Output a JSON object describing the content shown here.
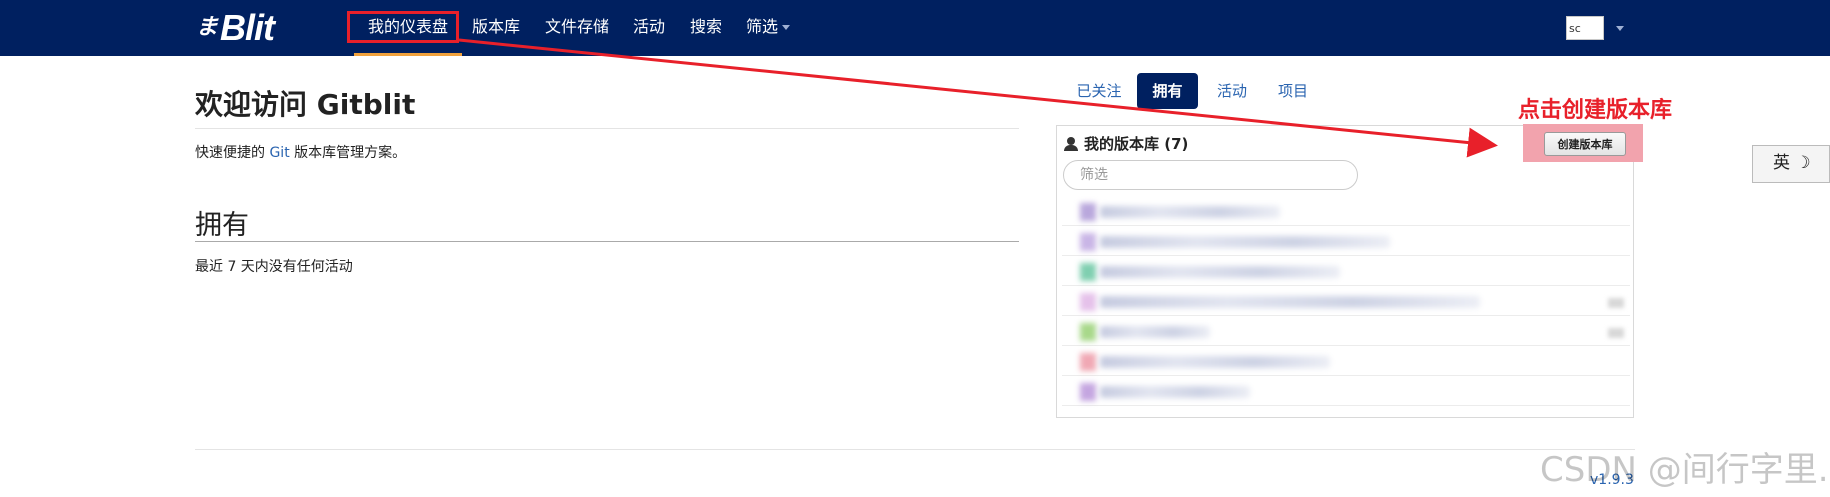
{
  "navbar": {
    "logo_mark": "ま",
    "logo_text": "Blit",
    "items": [
      {
        "label": "我的仪表盘"
      },
      {
        "label": "版本库"
      },
      {
        "label": "文件存储"
      },
      {
        "label": "活动"
      },
      {
        "label": "搜索"
      },
      {
        "label": "筛选"
      }
    ],
    "avatar_alt": "sc"
  },
  "main": {
    "title": "欢迎访问 Gitblit",
    "tagline_prefix": "快速便捷的 ",
    "tagline_link": "Git",
    "tagline_suffix": " 版本库管理方案。",
    "section_title": "拥有",
    "no_activity": "最近 7 天内没有任何活动"
  },
  "tabs": [
    {
      "label": "已关注"
    },
    {
      "label": "拥有"
    },
    {
      "label": "活动"
    },
    {
      "label": "项目"
    }
  ],
  "repo_panel": {
    "title": "我的版本库 (7)",
    "filter_placeholder": "筛选",
    "create_button": "创建版本库",
    "rows": [
      {
        "color": "#b9a7dc"
      },
      {
        "color": "#c9b5e6"
      },
      {
        "color": "#7fcfb0"
      },
      {
        "color": "#e5c1ea"
      },
      {
        "color": "#a8d88a"
      },
      {
        "color": "#f0a8b4"
      },
      {
        "color": "#c4a5e0"
      }
    ]
  },
  "annotation": {
    "label": "点击创建版本库",
    "color": "#e8202a"
  },
  "ime": {
    "label": "英 ☽"
  },
  "footer": {
    "version": "v1.9.3",
    "watermark": "CSDN @间行字里."
  },
  "colors": {
    "navbar": "#002060",
    "link": "#2a64b0",
    "active_underline": "#f0a13c"
  }
}
